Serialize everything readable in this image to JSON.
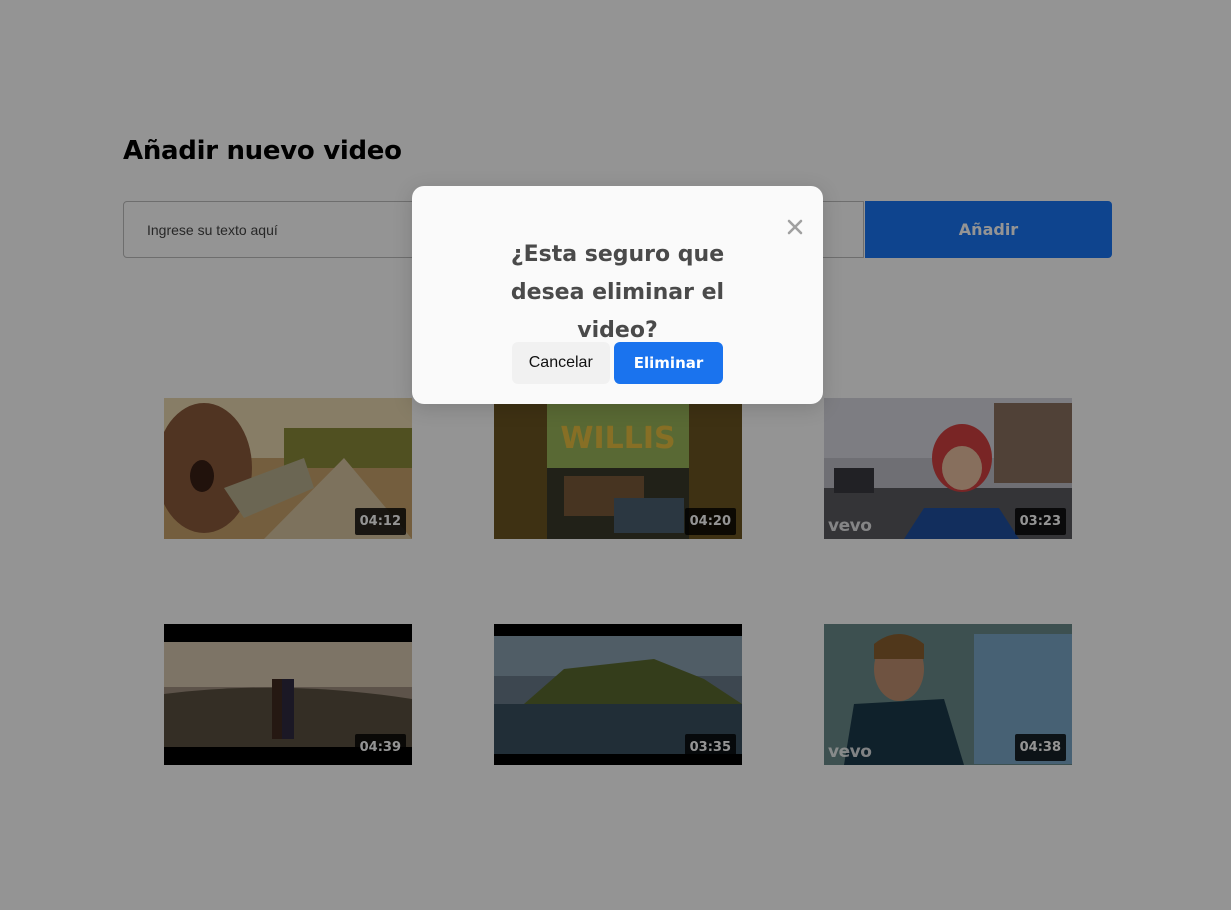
{
  "page": {
    "title": "Añadir nuevo video",
    "input_placeholder": "Ingrese su texto aquí",
    "add_label": "Añadir"
  },
  "videos": [
    {
      "duration": "04:12"
    },
    {
      "duration": "04:20",
      "thumb_text": "WILLIS"
    },
    {
      "duration": "03:23",
      "brand": "vevo"
    },
    {
      "duration": "04:39"
    },
    {
      "duration": "03:35"
    },
    {
      "duration": "04:38",
      "brand": "vevo"
    }
  ],
  "modal": {
    "message": "¿Esta seguro que desea eliminar el video?",
    "cancel_label": "Cancelar",
    "confirm_label": "Eliminar",
    "close_icon": "close-icon"
  },
  "colors": {
    "accent": "#1976f5",
    "overlay": "rgba(0,0,0,0.42)",
    "modal_bg": "#fafafa"
  }
}
